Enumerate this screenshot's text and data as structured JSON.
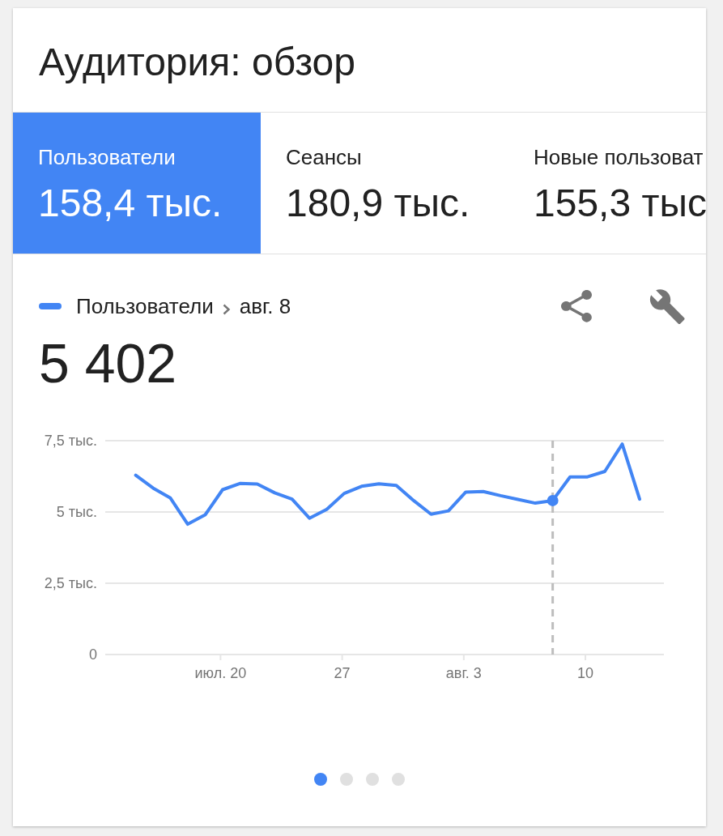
{
  "title": "Аудитория: обзор",
  "tabs": [
    {
      "label": "Пользователи",
      "value": "158,4 тыс.",
      "selected": true
    },
    {
      "label": "Сеансы",
      "value": "180,9 тыс.",
      "selected": false
    },
    {
      "label": "Новые пользоват",
      "value": "155,3 тыс",
      "selected": false
    }
  ],
  "chart": {
    "selected_value": "5 402",
    "chart_data": {
      "type": "line",
      "categories": [
        null,
        null,
        null,
        null,
        null,
        "июл. 20",
        null,
        null,
        null,
        null,
        null,
        null,
        "27",
        null,
        null,
        null,
        null,
        null,
        null,
        "авг. 3",
        null,
        null,
        null,
        null,
        null,
        null,
        "10",
        null,
        null,
        null
      ],
      "series": [
        {
          "name": "Пользователи",
          "color": "#4285f4",
          "values": [
            6.29,
            5.84,
            5.49,
            4.57,
            4.9,
            5.78,
            6.0,
            5.98,
            5.67,
            5.45,
            4.78,
            5.09,
            5.65,
            5.9,
            5.99,
            5.93,
            5.4,
            4.92,
            5.04,
            5.7,
            5.72,
            5.57,
            5.44,
            5.31,
            5.4,
            6.23,
            6.23,
            6.42,
            7.38,
            5.45
          ]
        },
        {
          "name": "авг. 8",
          "color": "#4285f4",
          "marker": "circle",
          "values": [
            null,
            null,
            null,
            null,
            null,
            null,
            null,
            null,
            null,
            null,
            null,
            null,
            null,
            null,
            null,
            null,
            null,
            null,
            null,
            null,
            null,
            null,
            null,
            null,
            5.4,
            null,
            null,
            null,
            null,
            null
          ]
        }
      ],
      "ylim": [
        0,
        7.5
      ],
      "yticks": [
        {
          "value": 0,
          "label": "0"
        },
        {
          "value": 2.5,
          "label": "2,5 тыс."
        },
        {
          "value": 5,
          "label": "5 тыс."
        },
        {
          "value": 7.5,
          "label": "7,5 тыс."
        }
      ]
    }
  },
  "pages": [
    {
      "selected": true
    },
    {
      "selected": false
    },
    {
      "selected": false
    },
    {
      "selected": false
    }
  ]
}
